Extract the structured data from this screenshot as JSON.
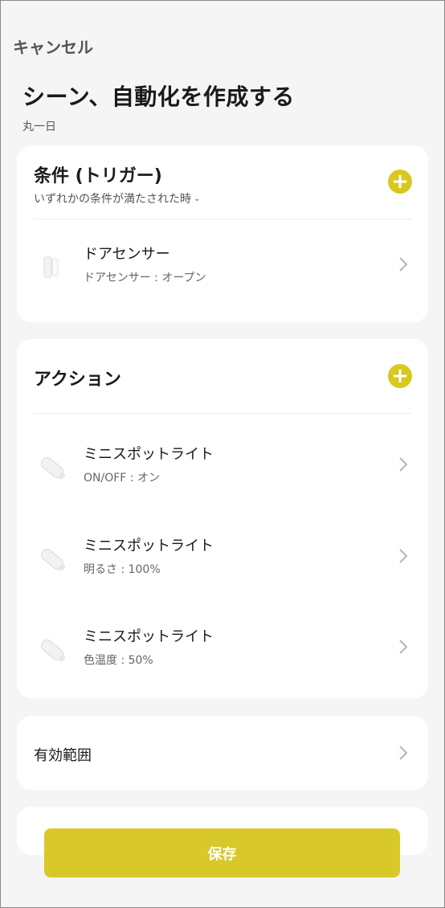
{
  "header": {
    "cancel_label": "キャンセル",
    "title": "シーン、自動化を作成する",
    "subtitle": "丸一日"
  },
  "conditions": {
    "title": "条件 (トリガー)",
    "mode_label": "いずれかの条件が満たされた時",
    "items": [
      {
        "name": "ドアセンサー",
        "detail": "ドアセンサー : オープン",
        "icon": "door-sensor-icon"
      }
    ]
  },
  "actions": {
    "title": "アクション",
    "items": [
      {
        "name": "ミニスポットライト",
        "detail": "ON/OFF : オン",
        "icon": "spotlight-icon"
      },
      {
        "name": "ミニスポットライト",
        "detail": "明るさ : 100%",
        "icon": "spotlight-icon"
      },
      {
        "name": "ミニスポットライト",
        "detail": "色温度 : 50%",
        "icon": "spotlight-icon"
      }
    ]
  },
  "scope": {
    "label": "有効範囲"
  },
  "footer": {
    "save_label": "保存"
  },
  "colors": {
    "accent": "#d9c820",
    "background": "#f5f5f5",
    "card": "#ffffff"
  }
}
